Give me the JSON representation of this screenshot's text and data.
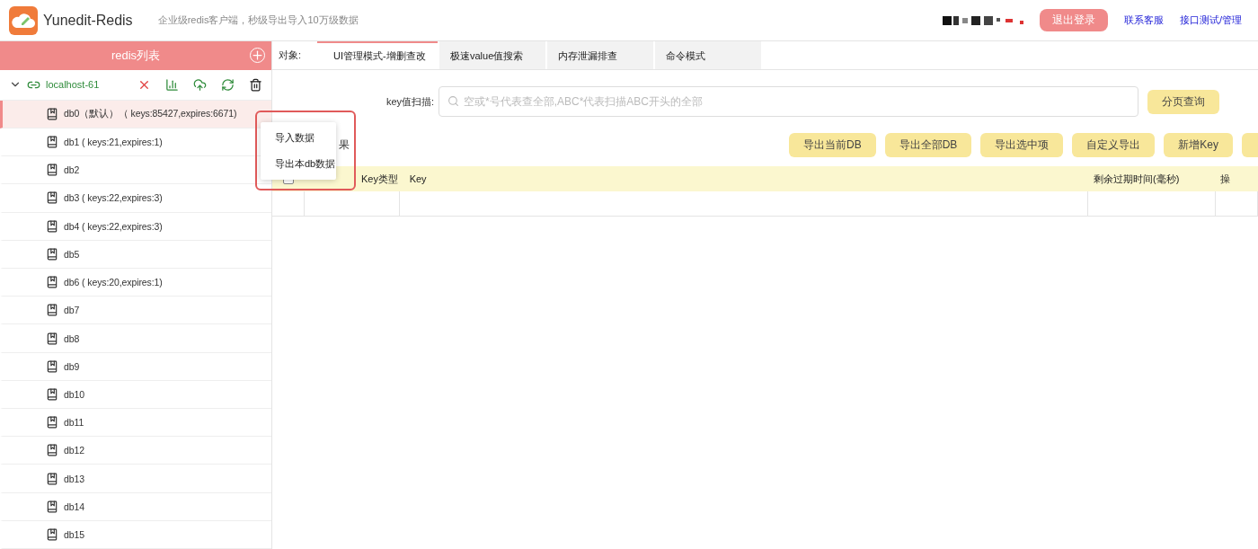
{
  "app": {
    "name": "Yunedit-Redis",
    "slogan": "企业级redis客户端，秒级导出导入10万级数据"
  },
  "header_actions": {
    "logout": "退出登录",
    "links": [
      "联系客服",
      "接口测试/管理"
    ]
  },
  "sidebar": {
    "title": "redis列表",
    "connection": {
      "name": "localhost-61",
      "expanded": true
    },
    "databases": [
      {
        "label": "db0（默认）（ keys:85427,expires:6671)",
        "selected": true
      },
      {
        "label": "db1 ( keys:21,expires:1)",
        "selected": false
      },
      {
        "label": "db2",
        "selected": false
      },
      {
        "label": "db3 ( keys:22,expires:3)",
        "selected": false
      },
      {
        "label": "db4 ( keys:22,expires:3)",
        "selected": false
      },
      {
        "label": "db5",
        "selected": false
      },
      {
        "label": "db6 ( keys:20,expires:1)",
        "selected": false
      },
      {
        "label": "db7",
        "selected": false
      },
      {
        "label": "db8",
        "selected": false
      },
      {
        "label": "db9",
        "selected": false
      },
      {
        "label": "db10",
        "selected": false
      },
      {
        "label": "db11",
        "selected": false
      },
      {
        "label": "db12",
        "selected": false
      },
      {
        "label": "db13",
        "selected": false
      },
      {
        "label": "db14",
        "selected": false
      },
      {
        "label": "db15",
        "selected": false
      }
    ]
  },
  "context_menu": [
    "导入数据",
    "导出本db数据"
  ],
  "object_label": "对象:",
  "tabs": [
    {
      "label": "UI管理模式-增删查改",
      "selected": true
    },
    {
      "label": "极速value值搜索",
      "selected": false
    },
    {
      "label": "内存泄漏排查",
      "selected": false
    },
    {
      "label": "命令模式",
      "selected": false
    }
  ],
  "scan": {
    "label": "key值扫描:",
    "placeholder": "空或*号代表查全部,ABC*代表扫描ABC开头的全部",
    "button": "分页查询"
  },
  "result_fragment": "果",
  "actions": [
    "导出当前DB",
    "导出全部DB",
    "导出选中项",
    "自定义导出",
    "新增Key"
  ],
  "table": {
    "select_all": false,
    "columns": [
      "Key类型",
      "Key",
      "剩余过期时间(毫秒)",
      "操"
    ]
  }
}
